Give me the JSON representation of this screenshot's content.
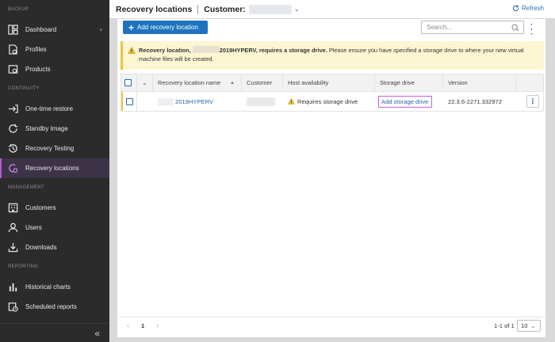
{
  "sidebar": {
    "sections": [
      {
        "label": "BACKUP",
        "items": [
          {
            "label": "Dashboard",
            "icon": "dashboard-icon",
            "caret": true
          },
          {
            "label": "Profiles",
            "icon": "profiles-icon"
          },
          {
            "label": "Products",
            "icon": "products-icon"
          }
        ]
      },
      {
        "label": "CONTINUITY",
        "items": [
          {
            "label": "One-time restore",
            "icon": "restore-icon"
          },
          {
            "label": "Standby Image",
            "icon": "standby-image-icon"
          },
          {
            "label": "Recovery Testing",
            "icon": "recovery-testing-icon"
          },
          {
            "label": "Recovery locations",
            "icon": "recovery-locations-icon",
            "active": true
          }
        ]
      },
      {
        "label": "MANAGEMENT",
        "items": [
          {
            "label": "Customers",
            "icon": "customers-icon"
          },
          {
            "label": "Users",
            "icon": "users-icon"
          },
          {
            "label": "Downloads",
            "icon": "downloads-icon"
          }
        ]
      },
      {
        "label": "REPORTING",
        "items": [
          {
            "label": "Historical charts",
            "icon": "chart-icon"
          },
          {
            "label": "Scheduled reports",
            "icon": "scheduled-reports-icon"
          }
        ]
      }
    ],
    "collapse_glyph": "«"
  },
  "header": {
    "title": "Recovery locations",
    "customer_label": "Customer:",
    "refresh_label": "Refresh"
  },
  "toolbar": {
    "add_label": "Add recovery location",
    "search_placeholder": "Search..."
  },
  "alert": {
    "bold_prefix": "Recovery location,",
    "bold_suffix": "2019HYPERV, requires a storage drive.",
    "message": " Please ensure you have specified a storage drive to where your new virtual machine files will be created."
  },
  "table": {
    "headers": {
      "name": "Recovery location name",
      "customer": "Customer",
      "host": "Host availability",
      "storage": "Storage drive",
      "version": "Version"
    },
    "rows": [
      {
        "name": "2019HYPERV",
        "host": "Requires storage drive",
        "storage": "Add storage drive",
        "version": "22.3.6-2271.332972"
      }
    ]
  },
  "footer": {
    "page": "1",
    "range": "1-1 of 1",
    "per_page": "10"
  },
  "colors": {
    "accent": "#1e73be",
    "active_marker": "#b45bd6",
    "warning": "#f2c232",
    "sidebar_bg": "#2b2b2b"
  }
}
